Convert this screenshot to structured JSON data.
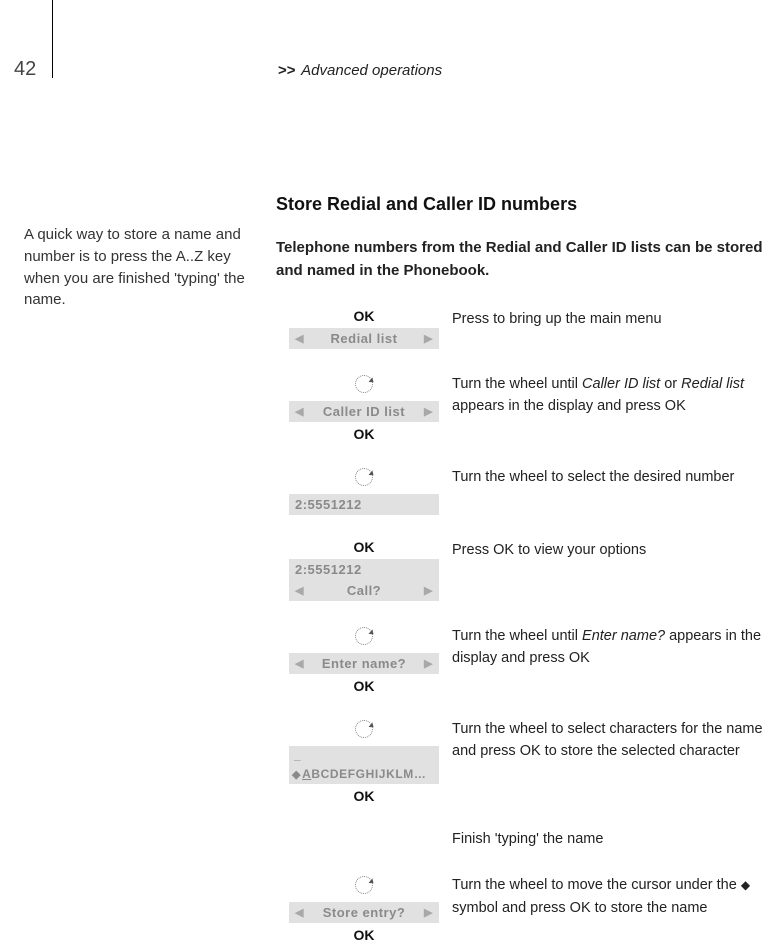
{
  "page_number": "42",
  "header_chevrons": ">>",
  "header_text": "Advanced operations",
  "sidebar_tip": "A quick way to store a name and number is to press the A..Z key when you are finished 'typing' the name.",
  "section_title": "Store Redial and Caller ID numbers",
  "intro": "Telephone numbers from the Redial and Caller ID lists can be stored and named in the Phonebook.",
  "labels": {
    "ok": "OK",
    "redial_list": "Redial list",
    "caller_id_list": "Caller ID list",
    "number_entry": "2:5551212",
    "call_prompt": "Call?",
    "enter_name": "Enter name?",
    "cursor": "_",
    "char_row": "BCDEFGHIJKLM…",
    "store_entry": "Store entry?",
    "arrow_left": "◀",
    "arrow_right": "▶",
    "underlined_a": "A"
  },
  "descriptions": {
    "d1": "Press to bring up the main menu",
    "d2a": "Turn the wheel until ",
    "d2b": "Caller ID list",
    "d2c": " or ",
    "d2d": "Redial list",
    "d2e": " appears in the display and press OK",
    "d3": "Turn the wheel to select the desired number",
    "d4": "Press OK to view your options",
    "d5a": "Turn the wheel until ",
    "d5b": "Enter name?",
    "d5c": " appears in the display and press OK",
    "d6": "Turn the wheel to select characters for the name and press OK to store the selected character",
    "d7": "Finish 'typing' the name",
    "d8a": "Turn the wheel to move the cursor under the ",
    "d8b": " symbol and press OK to store the name"
  }
}
